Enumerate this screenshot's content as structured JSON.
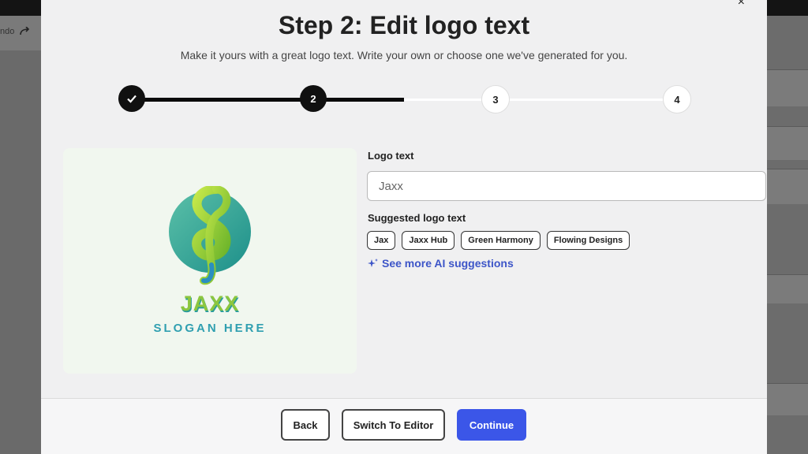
{
  "background_app": {
    "undo_label": "ndo"
  },
  "modal": {
    "title": "Step 2: Edit logo text",
    "subtitle": "Make it yours with a great logo text. Write your own or choose one we've generated for you.",
    "close_glyph": "×"
  },
  "stepper": {
    "steps": [
      {
        "label": "✓",
        "state": "done"
      },
      {
        "label": "2",
        "state": "active"
      },
      {
        "label": "3",
        "state": "todo"
      },
      {
        "label": "4",
        "state": "todo"
      }
    ]
  },
  "preview": {
    "logo_name": "JAXX",
    "slogan": "SLOGAN HERE"
  },
  "form": {
    "logo_text_label": "Logo text",
    "logo_text_value": "Jaxx",
    "suggested_label": "Suggested logo text",
    "suggestions": [
      "Jax",
      "Jaxx Hub",
      "Green Harmony",
      "Flowing Designs"
    ],
    "ai_link": "See more AI suggestions"
  },
  "footer": {
    "back": "Back",
    "switch": "Switch To Editor",
    "continue": "Continue"
  },
  "colors": {
    "primary": "#3b56e8",
    "link": "#3d55c8",
    "logo_green": "#8cc63f",
    "logo_teal": "#2f9fb0"
  }
}
